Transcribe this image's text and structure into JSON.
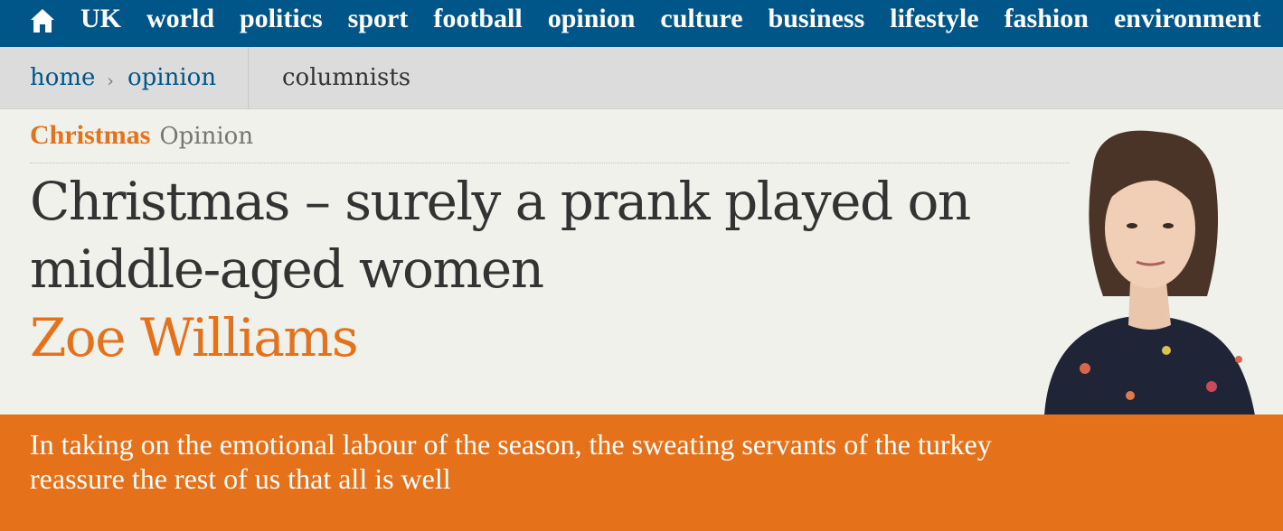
{
  "nav": {
    "home_icon": "home-icon",
    "items": [
      "UK",
      "world",
      "politics",
      "sport",
      "football",
      "opinion",
      "culture",
      "business",
      "lifestyle",
      "fashion",
      "environment"
    ]
  },
  "breadcrumb": {
    "home": "home",
    "separator": "›",
    "opinion": "opinion",
    "columnists": "columnists"
  },
  "article": {
    "series": "Christmas",
    "tone": "Opinion",
    "headline": "Christmas – surely a prank played on middle-aged women",
    "byline": "Zoe Williams",
    "standfirst": "In taking on the emotional labour of the season, the sweating servants of the turkey reassure the rest of us that all is well"
  },
  "colors": {
    "nav_bg": "#005689",
    "accent": "#e6711b",
    "background": "#f1f1ec"
  }
}
